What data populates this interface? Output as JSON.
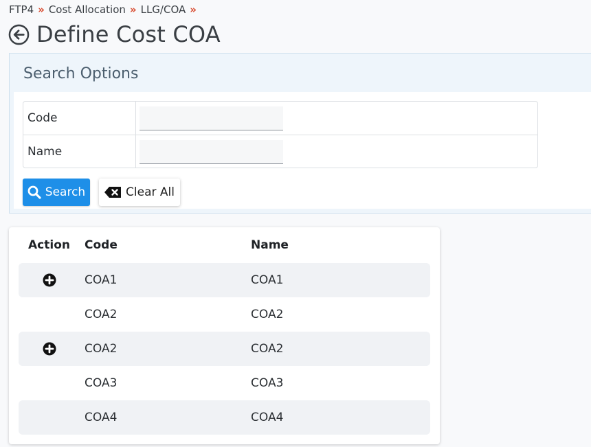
{
  "breadcrumb": {
    "items": [
      "FTP4",
      "Cost Allocation",
      "LLG/COA"
    ],
    "separator": "»"
  },
  "page": {
    "title": "Define Cost COA"
  },
  "search": {
    "title": "Search Options",
    "fields": [
      {
        "label": "Code",
        "value": "",
        "placeholder": ""
      },
      {
        "label": "Name",
        "value": "",
        "placeholder": ""
      }
    ],
    "search_label": "Search",
    "clear_label": "Clear All"
  },
  "results": {
    "columns": [
      "Action",
      "Code",
      "Name"
    ],
    "rows": [
      {
        "has_add": true,
        "code": "COA1",
        "name": "COA1"
      },
      {
        "has_add": false,
        "code": "COA2",
        "name": "COA2"
      },
      {
        "has_add": true,
        "code": "COA2",
        "name": "COA2"
      },
      {
        "has_add": false,
        "code": "COA3",
        "name": "COA3"
      },
      {
        "has_add": false,
        "code": "COA4",
        "name": "COA4"
      }
    ]
  },
  "colors": {
    "accent": "#1e8fe8",
    "breadcrumb_separator": "#d8492d",
    "panel_bg": "#eef5fb"
  },
  "icons": {
    "back": "arrow-left-circle-icon",
    "search": "magnifier-icon",
    "clear": "backspace-x-icon",
    "add": "plus-circle-icon"
  }
}
